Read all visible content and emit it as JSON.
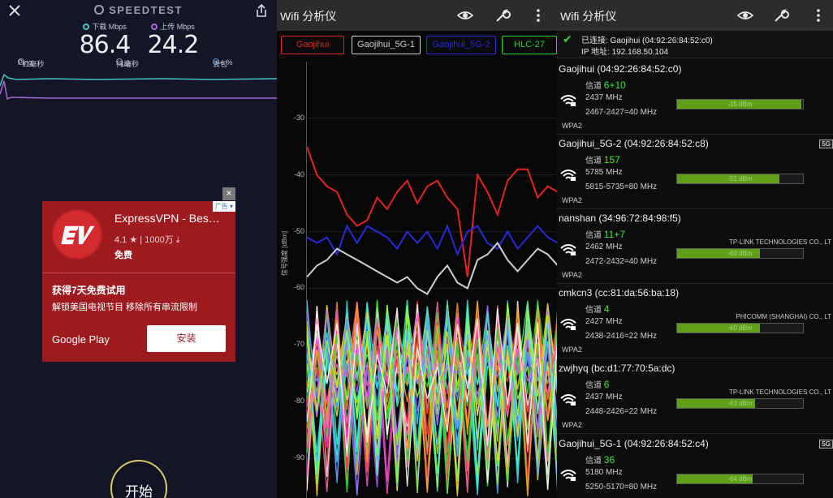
{
  "speedtest": {
    "brand": "SPEEDTEST",
    "download": {
      "label": "下载 Mbps",
      "value": "86.4"
    },
    "upload": {
      "label": "上传 Mbps",
      "value": "24.2"
    },
    "ping": {
      "label": "Ping",
      "value": "11毫秒"
    },
    "jitter": {
      "label": "抖动",
      "value": "1毫秒"
    },
    "loss": {
      "label": "丢包",
      "value": "— %"
    },
    "colors": {
      "download": "#45c2bd",
      "upload": "#a56ad6"
    },
    "start_label": "开始"
  },
  "ad": {
    "tag": "广告",
    "app_name": "ExpressVPN - Bes…",
    "rating": "4.1",
    "downloads": "1000万",
    "price": "免费",
    "trial": "获得7天免费试用",
    "desc": "解锁美国电视节目 移除所有串流限制",
    "store": "Google Play",
    "install": "安装"
  },
  "wifi_graph": {
    "title": "Wifi 分析仪",
    "chips": [
      {
        "label": "Gaojihui",
        "color": "#e02424"
      },
      {
        "label": "Gaojihui_5G-1",
        "color": "#cfcfcf"
      },
      {
        "label": "Gaojihui_5G-2",
        "color": "#2a2ad8"
      },
      {
        "label": "HLC-27",
        "color": "#28d028"
      }
    ],
    "yaxis_name": "信号强度 [dBm]",
    "chart_data": {
      "type": "line",
      "yticks": [
        -30,
        -40,
        -50,
        -60,
        -70,
        -80,
        -90
      ],
      "ylim": [
        -97,
        -20
      ],
      "series": [
        {
          "name": "Gaojihui",
          "color": "#e02424",
          "values": [
            -35,
            -40,
            -42,
            -43,
            -47,
            -49,
            -48,
            -44,
            -46,
            -43,
            -41,
            -45,
            -42,
            -41,
            -44,
            -46,
            -58,
            -40,
            -43,
            -47,
            -41,
            -39,
            -39,
            -44,
            -42,
            -43
          ]
        },
        {
          "name": "Gaojihui_5G-2",
          "color": "#2a2ad8",
          "values": [
            -51,
            -52,
            -51,
            -54,
            -49,
            -52,
            -49,
            -50,
            -51,
            -53,
            -50,
            -52,
            -50,
            -53,
            -49,
            -54,
            -50,
            -49,
            -52,
            -53,
            -50,
            -53,
            -51,
            -49,
            -51,
            -52
          ]
        },
        {
          "name": "Gaojihui_5G-1",
          "color": "#cfcfcf",
          "values": [
            -58,
            -56,
            -55,
            -53,
            -54,
            -55,
            -56,
            -57,
            -58,
            -59,
            -58,
            -60,
            -61,
            -58,
            -56,
            -59,
            -60,
            -55,
            -54,
            -52,
            -55,
            -57,
            -55,
            -53,
            -54,
            -56
          ]
        }
      ]
    }
  },
  "wifi_list": {
    "title": "Wifi 分析仪",
    "connected": {
      "l1": "已连接: Gaojihui (04:92:26:84:52:c0)",
      "l2": "IP 地址: 192.168.50.104"
    },
    "channel_label": "信道",
    "networks": [
      {
        "name": "Gaojihui (04:92:26:84:52:c0)",
        "channel": "6+10",
        "freq": "2437 MHz",
        "range": "2467-2427=40 MHz",
        "dbm": "-35 dBm",
        "level": 0.99,
        "security": "WPA2",
        "vendor": "",
        "tag": ""
      },
      {
        "name": "Gaojihui_5G-2 (04:92:26:84:52:c8)",
        "channel": "157",
        "freq": "5785 MHz",
        "range": "5815-5735=80 MHz",
        "dbm": "-51 dBm",
        "level": 0.81,
        "security": "WPA2",
        "vendor": "",
        "tag": "5G"
      },
      {
        "name": "nanshan (34:96:72:84:98:f5)",
        "channel": "11+7",
        "freq": "2462 MHz",
        "range": "2472-2432=40 MHz",
        "dbm": "-60 dBm",
        "level": 0.66,
        "security": "WPA2",
        "vendor": "TP-LINK TECHNOLOGIES CO., LT",
        "tag": ""
      },
      {
        "name": "cmkcn3 (cc:81:da:56:ba:18)",
        "channel": "4",
        "freq": "2427 MHz",
        "range": "2438-2416=22 MHz",
        "dbm": "-60 dBm",
        "level": 0.66,
        "security": "WPA2",
        "vendor": "PHICOMM (SHANGHAI) CO., LT",
        "tag": ""
      },
      {
        "name": "zwjhyq (bc:d1:77:70:5a:dc)",
        "channel": "6",
        "freq": "2437 MHz",
        "range": "2448-2426=22 MHz",
        "dbm": "-63 dBm",
        "level": 0.62,
        "security": "WPA2",
        "vendor": "TP-LINK TECHNOLOGIES CO., LT",
        "tag": ""
      },
      {
        "name": "Gaojihui_5G-1 (04:92:26:84:52:c4)",
        "channel": "36",
        "freq": "5180 MHz",
        "range": "5250-5170=80 MHz",
        "dbm": "-64 dBm",
        "level": 0.6,
        "security": "",
        "vendor": "",
        "tag": "5G"
      }
    ]
  }
}
